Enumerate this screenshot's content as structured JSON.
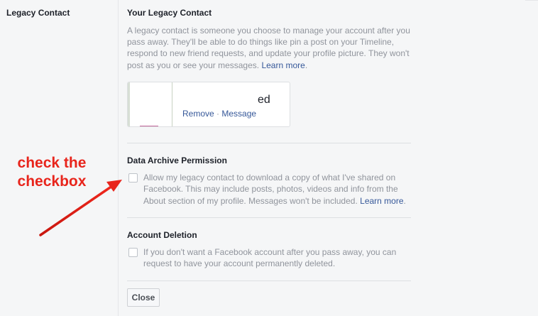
{
  "section": {
    "label": "Legacy Contact"
  },
  "legacy": {
    "heading": "Your Legacy Contact",
    "description": "A legacy contact is someone you choose to manage your account after you pass away. They'll be able to do things like pin a post on your Timeline, respond to new friend requests, and update your profile picture. They won't post as you or see your messages.",
    "learn_more": "Learn more",
    "contact": {
      "name_fragment": "ed",
      "remove": "Remove",
      "separator": " · ",
      "message": "Message"
    }
  },
  "archive": {
    "heading": "Data Archive Permission",
    "checkbox_checked": false,
    "text": "Allow my legacy contact to download a copy of what I've shared on Facebook. This may include posts, photos, videos and info from the About section of my profile. Messages won't be included.",
    "learn_more": "Learn more"
  },
  "deletion": {
    "heading": "Account Deletion",
    "checkbox_checked": false,
    "text": "If you don't want a Facebook account after you pass away, you can request to have your account permanently deleted."
  },
  "close_button": "Close",
  "annotation": {
    "line1": "check the",
    "line2": "checkbox",
    "color": "#e8251c"
  },
  "colors": {
    "link": "#365899",
    "muted_text": "#90949c",
    "background": "#f5f6f7"
  }
}
